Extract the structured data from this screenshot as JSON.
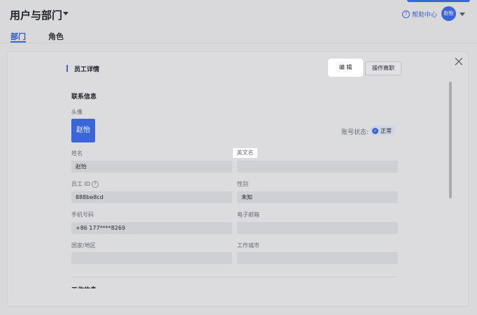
{
  "header": {
    "title": "用户与部门",
    "help_label": "帮助中心",
    "help_icon": "?",
    "avatar_text": "赵怡"
  },
  "tabs": [
    {
      "label": "部门",
      "active": true
    },
    {
      "label": "角色",
      "active": false
    }
  ],
  "panel": {
    "section_title": "员工详情",
    "edit_button": "编 辑",
    "leave_button": "操作离职",
    "group_title": "联系信息",
    "photo_label": "头像",
    "photo_text": "赵怡",
    "account_status_label": "账号状态:",
    "account_status_value": "正常",
    "fields": {
      "name_label": "姓名",
      "name_value": "赵怡",
      "english_name_label": "英文名",
      "english_name_value": "",
      "employee_id_label": "员工 ID",
      "employee_id_value": "888be8cd",
      "gender_label": "性别",
      "gender_value": "未知",
      "phone_label": "手机号码",
      "phone_value": "+86 177****8269",
      "email_label": "电子邮箱",
      "email_value": "",
      "region_label": "国家/地区",
      "region_value": "",
      "city_label": "工作城市",
      "city_value": ""
    },
    "next_group_title": "工作信息"
  },
  "colors": {
    "accent": "#3b66d9",
    "background": "#d9d9db"
  }
}
